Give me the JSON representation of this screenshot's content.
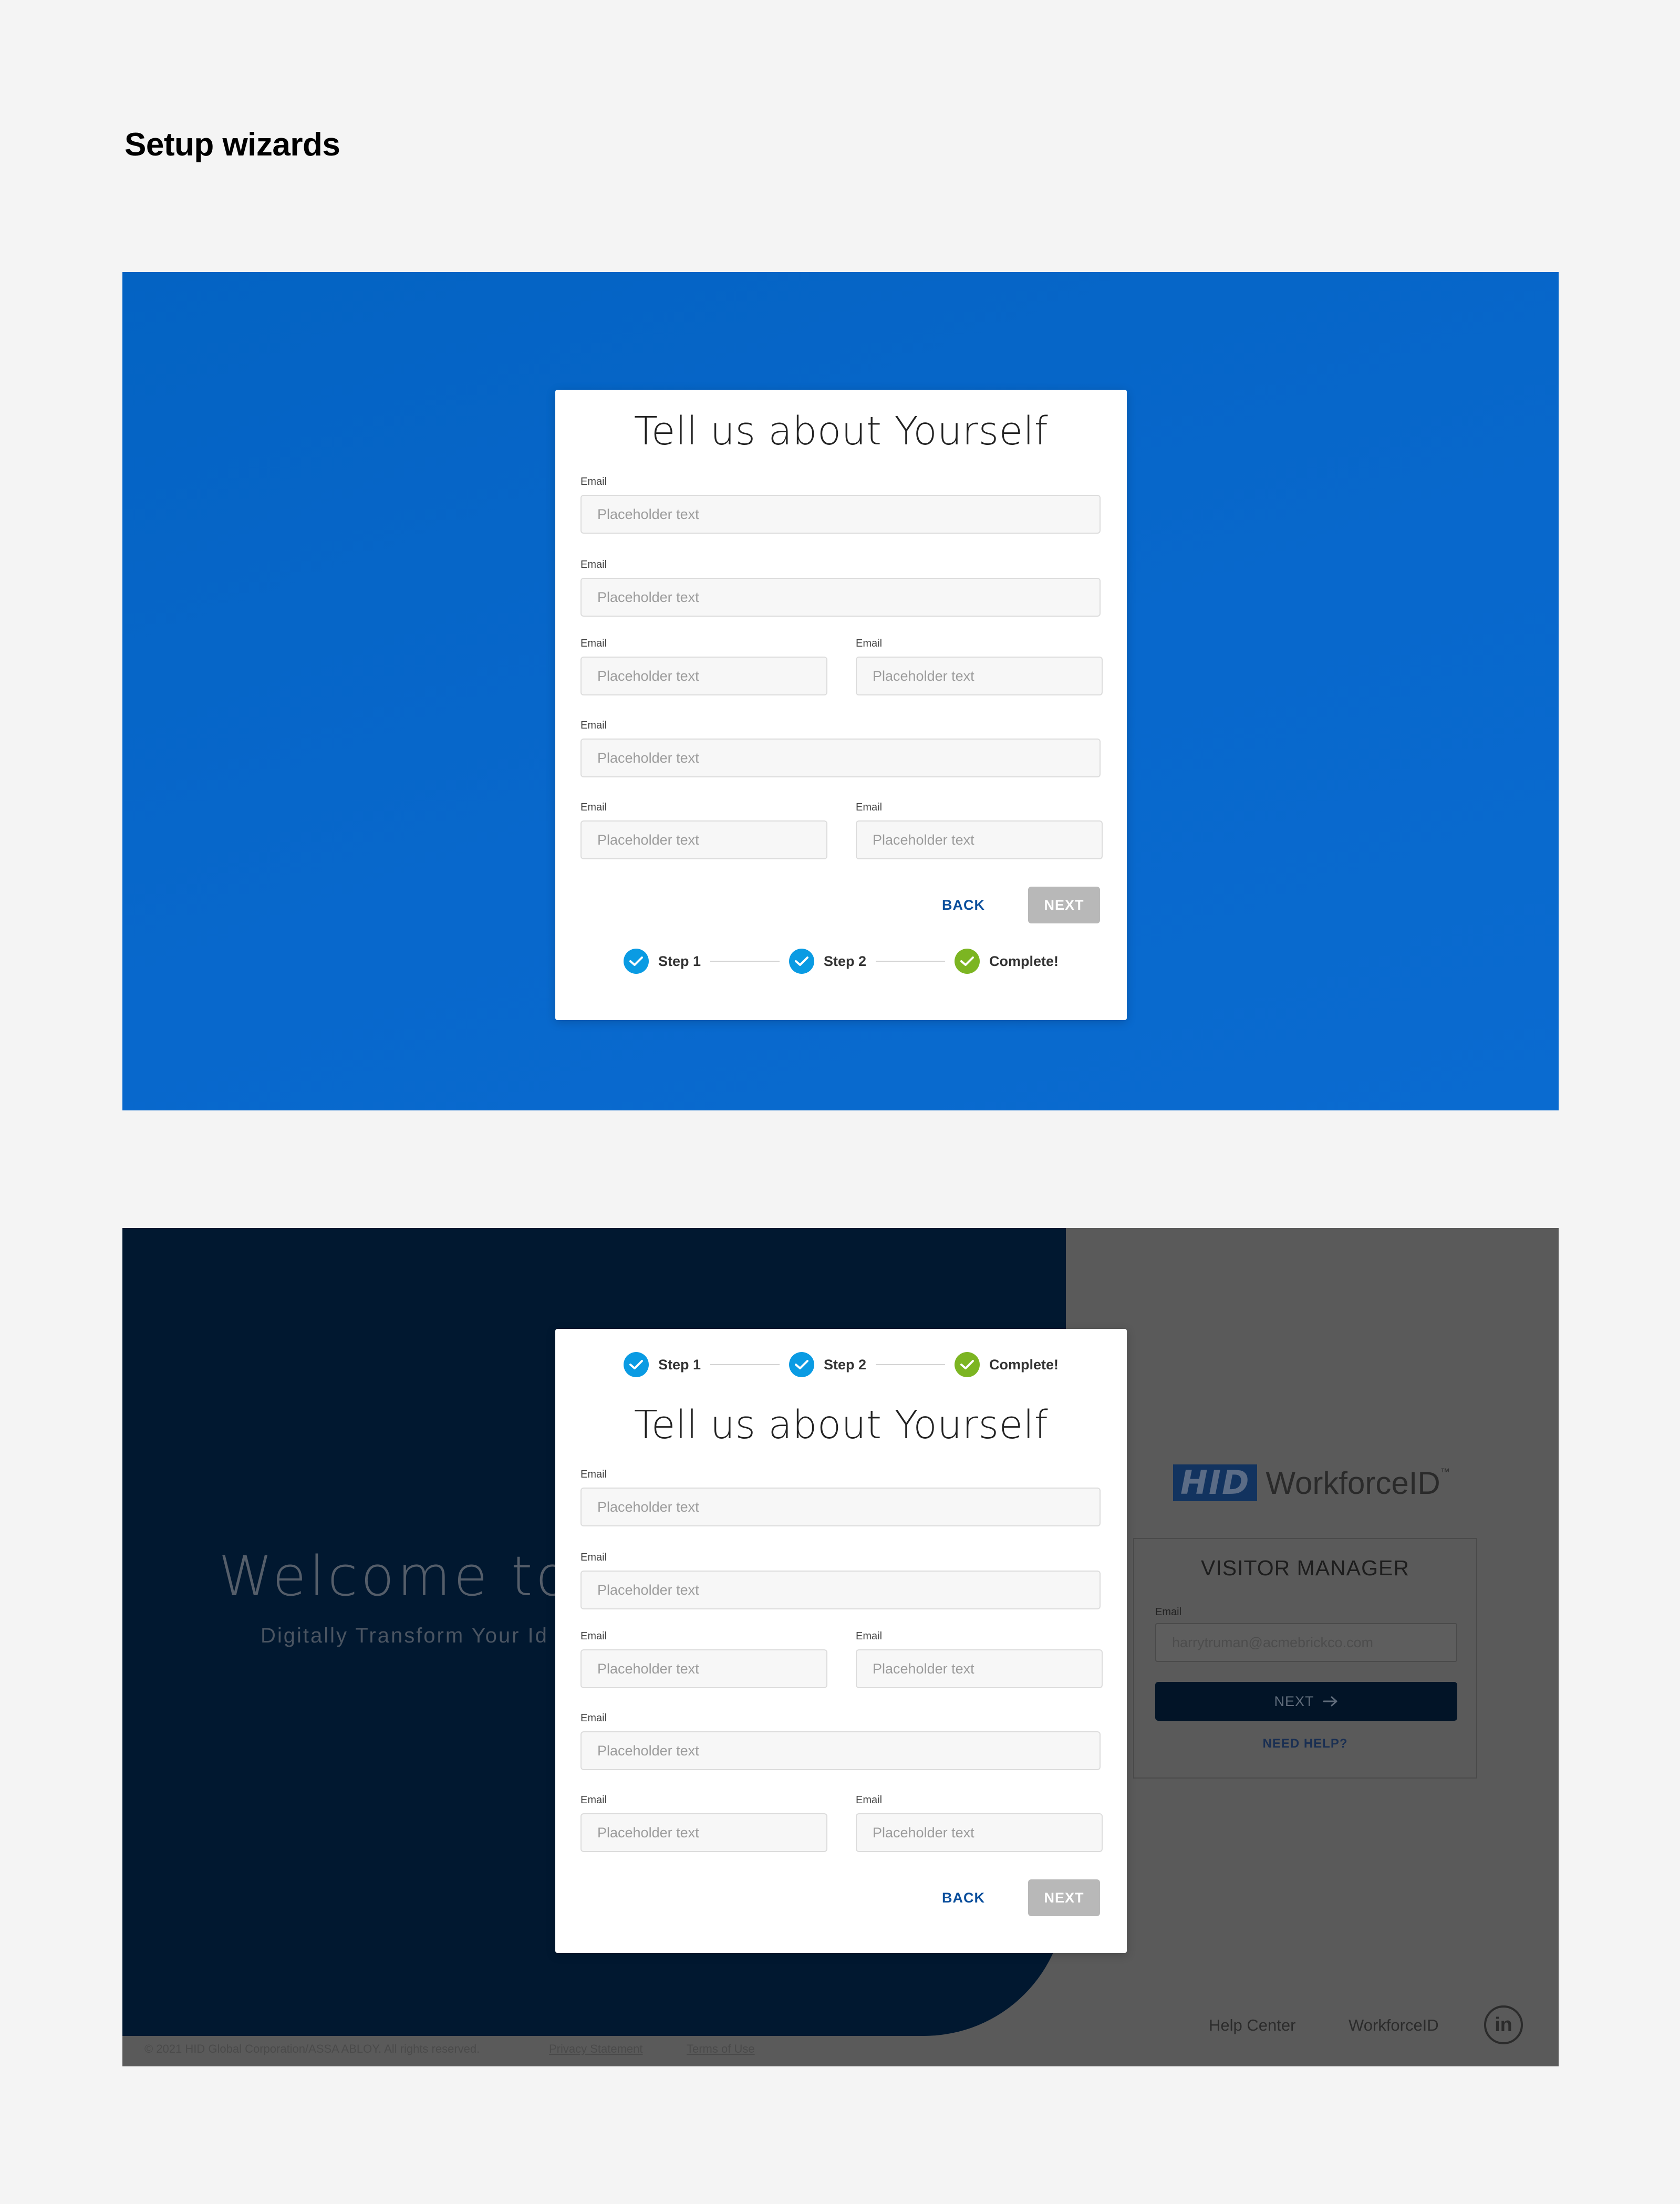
{
  "page": {
    "heading": "Setup wizards"
  },
  "wizard": {
    "title": "Tell us about Yourself",
    "field_label": "Email",
    "placeholder": "Placeholder text",
    "back_label": "BACK",
    "next_label": "NEXT",
    "steps": [
      {
        "label": "Step 1",
        "status": "done",
        "color": "#0a9be3"
      },
      {
        "label": "Step 2",
        "status": "done",
        "color": "#0a9be3"
      },
      {
        "label": "Complete!",
        "status": "complete",
        "color": "#7cb522"
      }
    ]
  },
  "background": {
    "welcome_title": "Welcome to",
    "welcome_subtitle": "Digitally Transform Your Id",
    "copyright": "© 2021 HID Global Corporation/ASSA ABLOY. All rights reserved.",
    "privacy_link": "Privacy Statement",
    "terms_link": "Terms of Use",
    "logo_mark": "HID",
    "logo_product": "WorkforceID",
    "logo_trademark": "™",
    "visitor_title": "VISITOR MANAGER",
    "visitor_email_label": "Email",
    "visitor_email_value": "harrytruman@acmebrickco.com",
    "visitor_next_label": "NEXT",
    "visitor_help_label": "NEED HELP?",
    "footer_help_center": "Help Center",
    "footer_workforceid": "WorkforceID",
    "linkedin_icon": "in"
  },
  "colors": {
    "artboard1_bg": "#0868cc",
    "artboard2_overlay": "#5a5a5a",
    "left_panel": "#011830",
    "next_disabled": "#b8b8b8",
    "back_link": "#0b4f9c"
  }
}
